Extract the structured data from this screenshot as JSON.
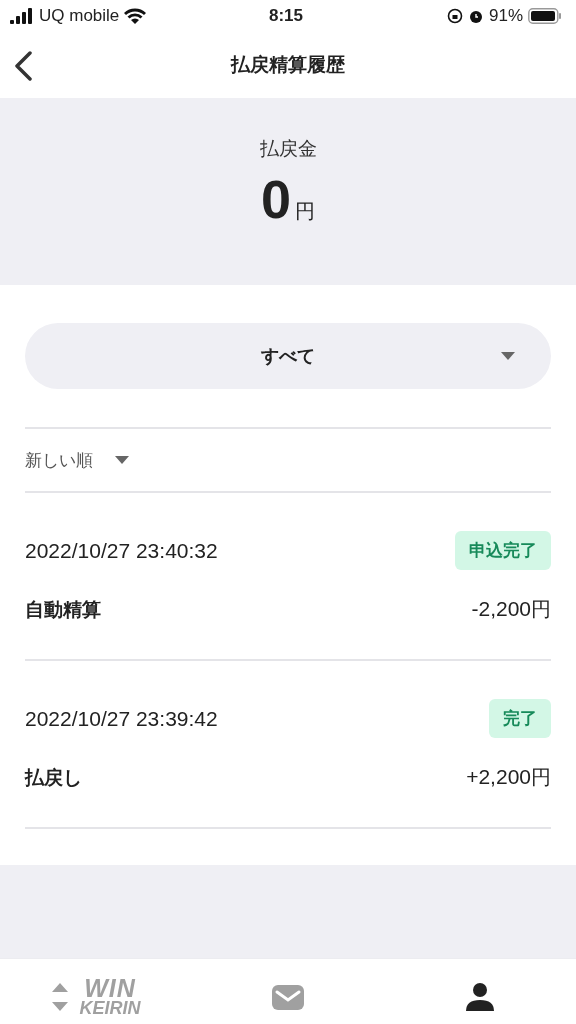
{
  "status_bar": {
    "carrier": "UQ mobile",
    "time": "8:15",
    "battery": "91%"
  },
  "nav": {
    "title": "払戻精算履歴"
  },
  "balance": {
    "label": "払戻金",
    "amount": "0",
    "unit": "円"
  },
  "filter": {
    "value": "すべて"
  },
  "sort": {
    "value": "新しい順"
  },
  "entries": [
    {
      "datetime": "2022/10/27 23:40:32",
      "status": "申込完了",
      "type": "自動精算",
      "amount": "-2,200",
      "unit": "円"
    },
    {
      "datetime": "2022/10/27 23:39:42",
      "status": "完了",
      "type": "払戻し",
      "amount": "+2,200",
      "unit": "円"
    }
  ],
  "tab_bar": [
    {
      "kind": "logo",
      "lines": [
        "WIN",
        "KEIRIN"
      ],
      "selected": false
    },
    {
      "kind": "mail",
      "selected": false
    },
    {
      "kind": "account",
      "selected": true
    }
  ]
}
